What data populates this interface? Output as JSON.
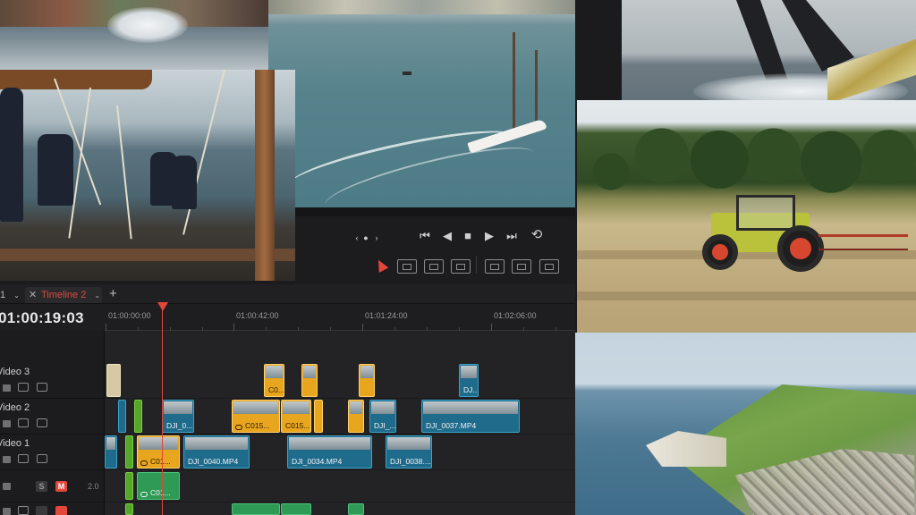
{
  "timeline": {
    "tab_active": "Timeline 2",
    "tab_prev_fragment": "1",
    "timecode": "01:00:19:03",
    "ruler": [
      "01:00:00:00",
      "01:00:42:00",
      "01:01:24:00",
      "01:02:06:00"
    ]
  },
  "tracks": {
    "video3": {
      "name": "Video 3"
    },
    "video2": {
      "name": "Video 2"
    },
    "video1": {
      "name": "Video 1"
    },
    "audio1": {
      "level": "2.0",
      "solo": "S",
      "mute": "M"
    }
  },
  "clips": {
    "v3_a": "C0...",
    "v3_b": "DJ...",
    "v2_a": "DJI_0...",
    "v2_b": "C015...",
    "v2_c": "C015...",
    "v2_d": "DJI_...",
    "v2_e": "DJI_0037.MP4",
    "v1_a": "C01...",
    "v1_b": "DJI_0040.MP4",
    "v1_c": "DJI_0034.MP4",
    "v1_d": "DJI_0038....",
    "a1_a": "C01..."
  },
  "colors": {
    "accent_red": "#e2473a",
    "clip_blue": "#1f6b8c",
    "clip_yellow": "#e8a51e",
    "clip_green": "#2f9a56"
  },
  "icons": [
    "prev-frame-icon",
    "play-reverse-icon",
    "stop-icon",
    "play-icon",
    "next-frame-icon",
    "loop-icon",
    "selection-tool-icon",
    "trim-tool-icon",
    "blade-tool-icon",
    "link-icon",
    "lock-icon",
    "monitor-icon"
  ]
}
